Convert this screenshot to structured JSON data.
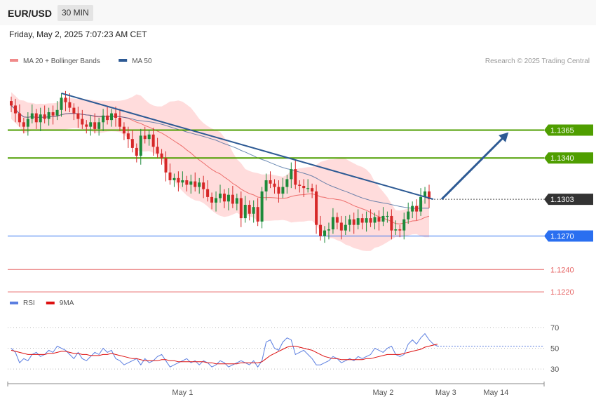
{
  "header": {
    "symbol": "EUR/USD",
    "timeframe": "30 MIN",
    "datetime": "Friday, May 2, 2025 7:07:23 AM CET"
  },
  "colors": {
    "ma20": "#e8514f",
    "bollinger_fill": "#ffd3d3",
    "ma50": "#2d5a94",
    "bull": "#1d8a3a",
    "bear": "#d62828",
    "resistance": "#4f9e00",
    "support_blue": "#2a6ff0",
    "support_red": "#e66464",
    "rsi": "#5b7ee0",
    "rsi_ma": "#dd1010",
    "last_price_box": "#333333"
  },
  "chart_data": [
    {
      "type": "line",
      "name": "price",
      "legend": [
        {
          "label": "MA 20 + Bollinger Bands",
          "color": "#f08a8a"
        },
        {
          "label": "MA 50",
          "color": "#2d5a94"
        }
      ],
      "copyright": "Research © 2025 Trading Central",
      "ylim": [
        1.121,
        1.1425
      ],
      "x_ticks": [
        {
          "label": "May 1",
          "index": 41
        },
        {
          "label": "May 2",
          "index": 89
        },
        {
          "label": "May 3",
          "index": 104
        },
        {
          "label": "May 14",
          "index": 116
        }
      ],
      "levels": [
        {
          "value": 1.1365,
          "label": "1.1365",
          "kind": "resistance"
        },
        {
          "value": 1.134,
          "label": "1.1340",
          "kind": "resistance"
        },
        {
          "value": 1.1303,
          "label": "1.1303",
          "kind": "last"
        },
        {
          "value": 1.127,
          "label": "1.1270",
          "kind": "support_blue"
        },
        {
          "value": 1.124,
          "label": "1.1240",
          "kind": "support_red"
        },
        {
          "value": 1.122,
          "label": "1.1220",
          "kind": "support_red"
        }
      ],
      "trendline": {
        "from": {
          "index": 12,
          "value": 1.1398
        },
        "to": {
          "index": 101,
          "value": 1.1303
        }
      },
      "arrow": {
        "from": {
          "index": 103,
          "value": 1.1303
        },
        "to": {
          "index": 119,
          "value": 1.1363
        }
      },
      "closes": [
        1.1387,
        1.138,
        1.1372,
        1.1368,
        1.1375,
        1.138,
        1.1372,
        1.1379,
        1.1375,
        1.1381,
        1.1378,
        1.1383,
        1.1394,
        1.139,
        1.1385,
        1.138,
        1.1375,
        1.137,
        1.1368,
        1.1372,
        1.1366,
        1.1372,
        1.1378,
        1.1374,
        1.138,
        1.1376,
        1.1368,
        1.1362,
        1.1357,
        1.1349,
        1.1342,
        1.136,
        1.1357,
        1.1361,
        1.135,
        1.1344,
        1.134,
        1.1327,
        1.132,
        1.1322,
        1.1318,
        1.132,
        1.1316,
        1.1319,
        1.1314,
        1.1318,
        1.1312,
        1.1305,
        1.13,
        1.1304,
        1.1308,
        1.1301,
        1.1307,
        1.1299,
        1.1304,
        1.1286,
        1.1298,
        1.129,
        1.1296,
        1.1283,
        1.131,
        1.132,
        1.1317,
        1.1314,
        1.1308,
        1.1314,
        1.1321,
        1.133,
        1.1316,
        1.1315,
        1.1313,
        1.1313,
        1.131,
        1.128,
        1.127,
        1.1275,
        1.1276,
        1.1287,
        1.1282,
        1.1275,
        1.128,
        1.1285,
        1.128,
        1.1286,
        1.1282,
        1.1286,
        1.1282,
        1.1287,
        1.1283,
        1.1288,
        1.1288,
        1.1275,
        1.1276,
        1.1275,
        1.1285,
        1.1292,
        1.1297,
        1.1292,
        1.1305,
        1.131,
        1.1303
      ]
    },
    {
      "type": "line",
      "name": "rsi",
      "legend": [
        {
          "label": "RSI",
          "color": "#5b7ee0"
        },
        {
          "label": "9MA",
          "color": "#dd1010"
        }
      ],
      "ylim": [
        22,
        80
      ],
      "y_ticks": [
        70,
        50,
        30
      ],
      "rsi": [
        50,
        46,
        36,
        40,
        38,
        44,
        46,
        42,
        44,
        48,
        46,
        52,
        50,
        48,
        44,
        40,
        46,
        40,
        38,
        42,
        46,
        44,
        50,
        46,
        48,
        40,
        38,
        34,
        36,
        38,
        40,
        34,
        40,
        36,
        38,
        42,
        44,
        38,
        32,
        34,
        36,
        38,
        40,
        36,
        38,
        34,
        38,
        36,
        32,
        34,
        38,
        36,
        32,
        34,
        36,
        38,
        36,
        34,
        38,
        32,
        38,
        56,
        58,
        50,
        48,
        56,
        60,
        58,
        44,
        46,
        48,
        44,
        40,
        34,
        34,
        36,
        38,
        42,
        40,
        36,
        38,
        40,
        38,
        42,
        40,
        42,
        44,
        50,
        48,
        46,
        50,
        52,
        44,
        42,
        44,
        54,
        58,
        54,
        60,
        64,
        58,
        54,
        52
      ],
      "rsi_ma": [
        48,
        47,
        46,
        45,
        44,
        44,
        44,
        44,
        44,
        45,
        45,
        46,
        47,
        47,
        46,
        45,
        45,
        44,
        44,
        43,
        43,
        43,
        44,
        44,
        45,
        44,
        43,
        42,
        41,
        40,
        40,
        39,
        38,
        38,
        38,
        38,
        39,
        39,
        38,
        38,
        37,
        37,
        37,
        37,
        37,
        37,
        37,
        36,
        36,
        35,
        35,
        35,
        35,
        35,
        35,
        36,
        36,
        36,
        36,
        36,
        37,
        40,
        43,
        45,
        47,
        49,
        51,
        52,
        52,
        51,
        50,
        49,
        48,
        46,
        44,
        42,
        41,
        40,
        40,
        39,
        39,
        39,
        39,
        39,
        39,
        40,
        40,
        41,
        42,
        43,
        44,
        44,
        44,
        44,
        45,
        46,
        47,
        48,
        49,
        51,
        52,
        53,
        54
      ]
    }
  ]
}
